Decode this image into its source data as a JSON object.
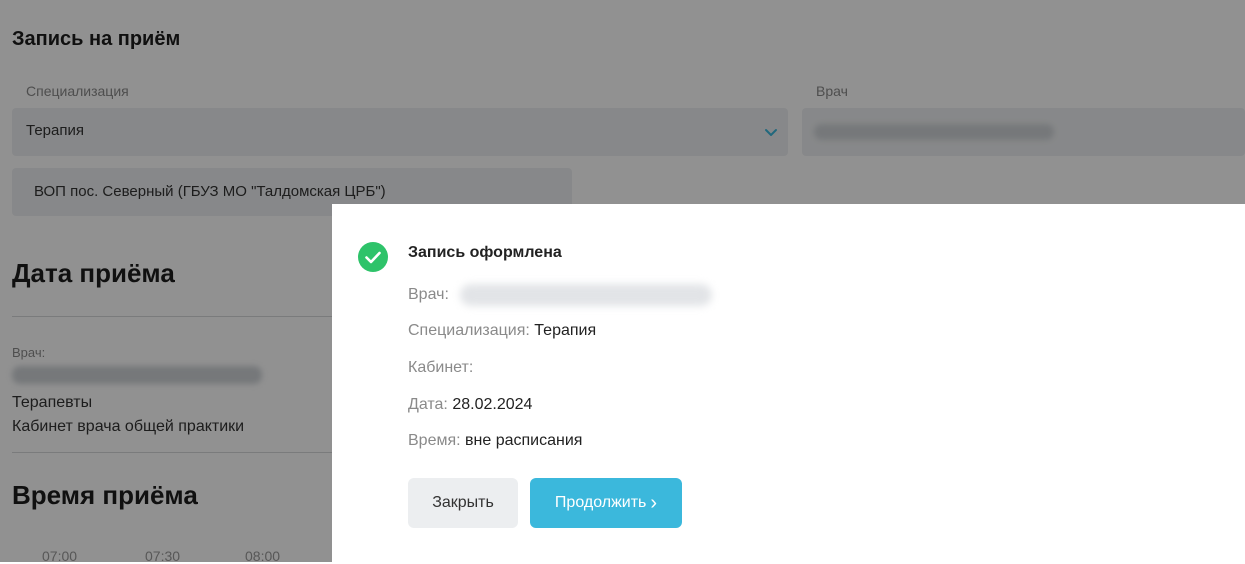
{
  "form": {
    "title": "Запись на приём",
    "specialization_label": "Специализация",
    "specialization_value": "Терапия",
    "doctor_label": "Врач",
    "clinic": "ВОП пос. Северный (ГБУЗ МО \"Талдомская ЦРБ\")"
  },
  "date_section": {
    "title": "Дата приёма",
    "doctor_label": "Врач:",
    "department": "Терапевты",
    "cabinet": "Кабинет врача общей практики"
  },
  "time_section": {
    "title": "Время приёма",
    "slots": [
      "07:00",
      "07:30",
      "08:00"
    ]
  },
  "dialog": {
    "title": "Запись оформлена",
    "doctor_label": "Врач:",
    "specialization_label": "Специализация:",
    "specialization_value": "Терапия",
    "cabinet_label": "Кабинет:",
    "date_label": "Дата:",
    "date_value": "28.02.2024",
    "time_label": "Время:",
    "time_value": "вне расписания",
    "close_label": "Закрыть",
    "continue_label": "Продолжить",
    "continue_icon": "chevron-right-icon",
    "status_icon": "check-circle-icon"
  },
  "colors": {
    "accent": "#3bb8dc",
    "success": "#2ec36a",
    "overlay": "rgba(0,0,0,0.43)"
  }
}
